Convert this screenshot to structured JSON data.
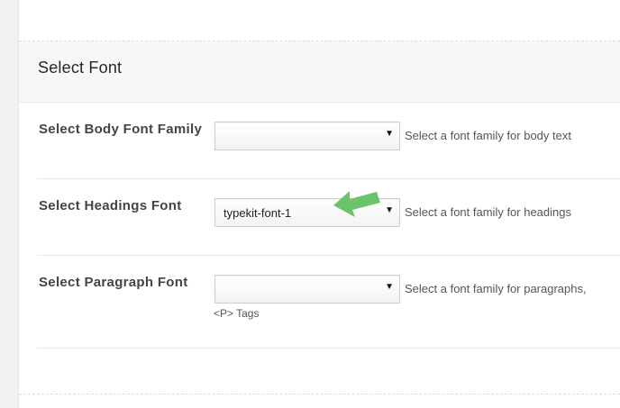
{
  "section": {
    "title": "Select Font"
  },
  "rows": [
    {
      "label": "Select Body Font Family",
      "selected": "",
      "description": "Select a font family for body text"
    },
    {
      "label": "Select Headings Font",
      "selected": "typekit-font-1",
      "description": "Select a font family for headings"
    },
    {
      "label": "Select Paragraph Font",
      "selected": "",
      "description": "Select a font family for paragraphs,",
      "description_2": "<P> Tags"
    }
  ],
  "icons": {
    "caret": "▼",
    "arrow": "green-pointer-arrow-icon"
  },
  "colors": {
    "arrow": "#6cc36c",
    "section_bg": "#f7f7f7",
    "label": "#444444"
  }
}
